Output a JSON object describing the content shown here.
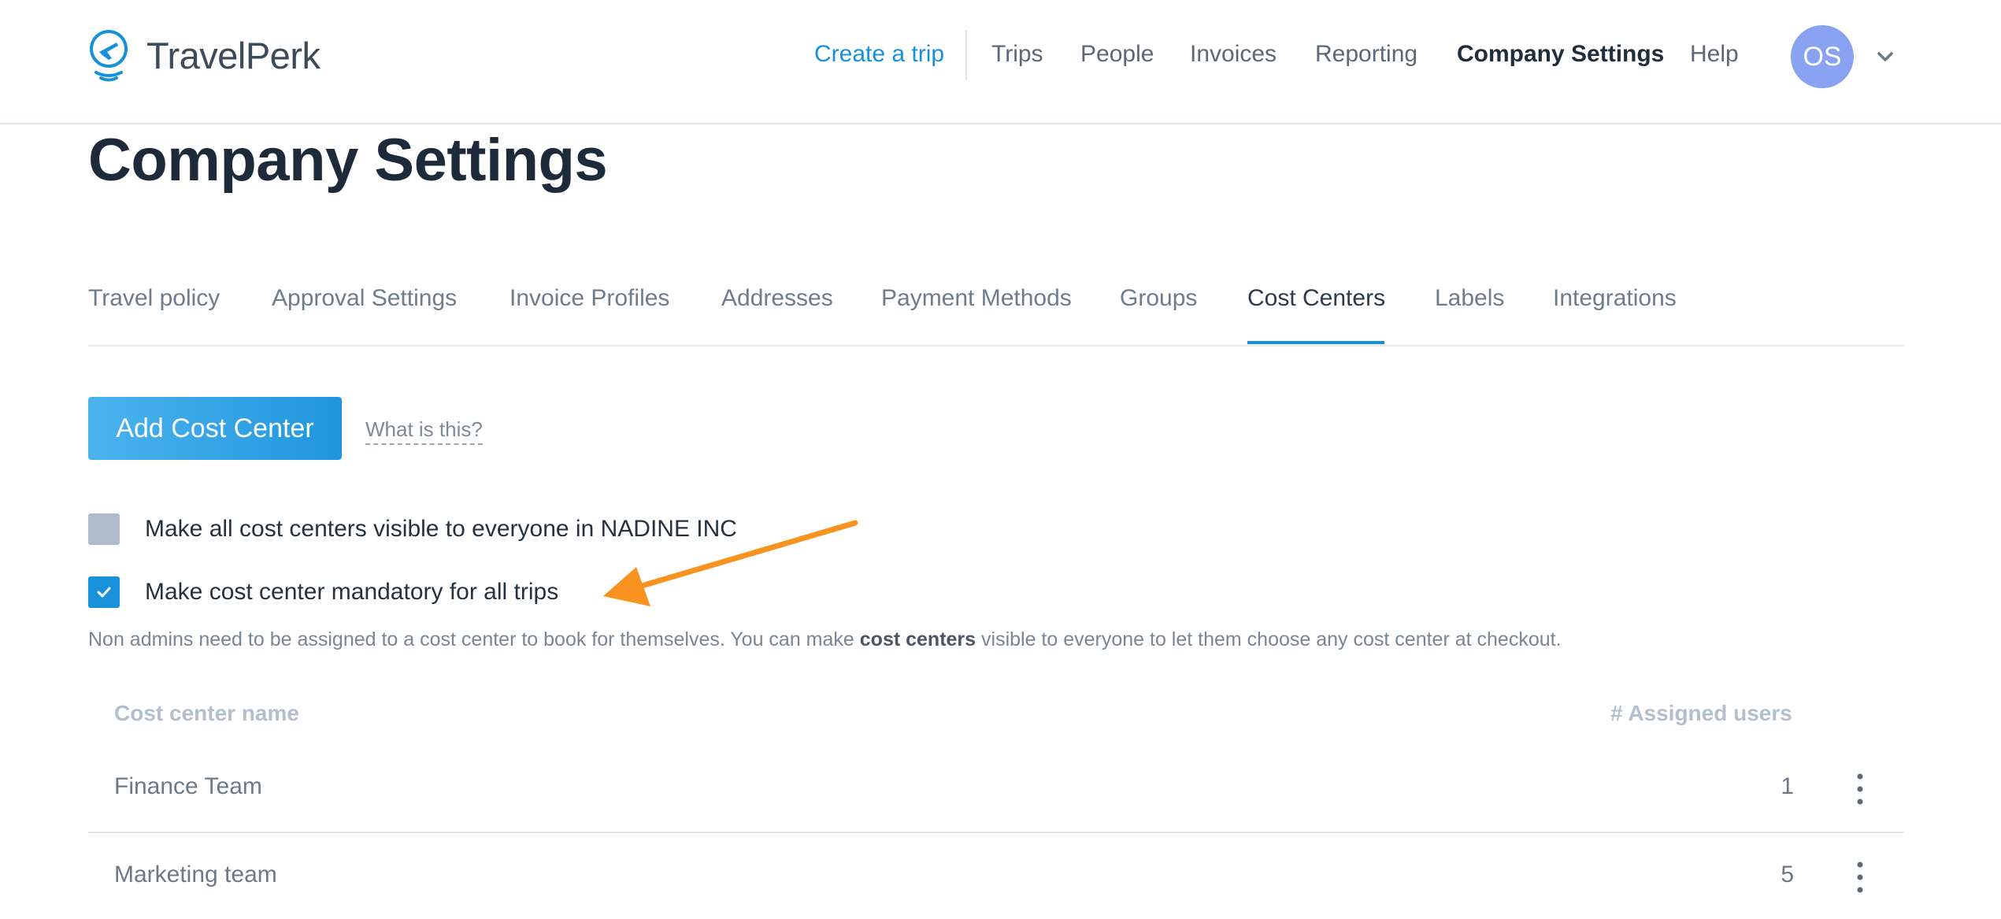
{
  "header": {
    "brand": "TravelPerk",
    "nav": {
      "create_trip": "Create a trip",
      "trips": "Trips",
      "people": "People",
      "invoices": "Invoices",
      "reporting": "Reporting",
      "company_settings": "Company Settings",
      "help": "Help"
    },
    "avatar_initials": "OS"
  },
  "page_title": "Company Settings",
  "tabs": [
    {
      "label": "Travel policy"
    },
    {
      "label": "Approval Settings"
    },
    {
      "label": "Invoice Profiles"
    },
    {
      "label": "Addresses"
    },
    {
      "label": "Payment Methods"
    },
    {
      "label": "Groups"
    },
    {
      "label": "Cost Centers",
      "active": true
    },
    {
      "label": "Labels"
    },
    {
      "label": "Integrations"
    }
  ],
  "actions": {
    "add_label": "Add Cost Center",
    "help_link": "What is this?"
  },
  "options": {
    "visible_all": {
      "label": "Make all cost centers visible to everyone in NADINE INC",
      "checked": false
    },
    "mandatory": {
      "label": "Make cost center mandatory for all trips",
      "checked": true
    }
  },
  "note": {
    "before": "Non admins need to be assigned to a cost center to book for themselves. You can make ",
    "bold": "cost centers",
    "after": " visible to everyone to let them choose any cost center at checkout."
  },
  "table": {
    "col_name": "Cost center name",
    "col_users": "# Assigned users",
    "rows": [
      {
        "name": "Finance Team",
        "users": "1"
      },
      {
        "name": "Marketing team",
        "users": "5"
      }
    ]
  },
  "colors": {
    "accent": "#1691d8",
    "annotation_arrow": "#f7931e"
  }
}
